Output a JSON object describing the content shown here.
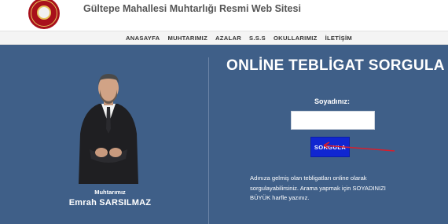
{
  "header": {
    "site_title": "Gültepe Mahallesi Muhtarlığı Resmi Web Sitesi"
  },
  "nav": {
    "items": [
      "ANASAYFA",
      "MUHTARIMIZ",
      "AZALAR",
      "S.S.S",
      "OKULLARIMIZ",
      "İLETİŞİM"
    ]
  },
  "profile": {
    "role": "Muhtarımız",
    "name": "Emrah SARSILMAZ"
  },
  "form": {
    "title": "ONLİNE TEBLİGAT SORGULA",
    "field_label": "Soyadınız:",
    "field_value": "",
    "field_placeholder": "",
    "button_label": "SORGULA",
    "help_text": "Adınıza gelmiş olan tebligatları online olarak sorgulayabilirsiniz. Arama yapmak için SOYADINIZI BÜYÜK harfle yazınız."
  },
  "colors": {
    "main_background": "#3f5f88",
    "button": "#1026d1",
    "arrow_annotation": "#d81e2c"
  },
  "icons": {
    "logo": "municipal-seal-icon",
    "annotation": "red-arrow-icon"
  }
}
